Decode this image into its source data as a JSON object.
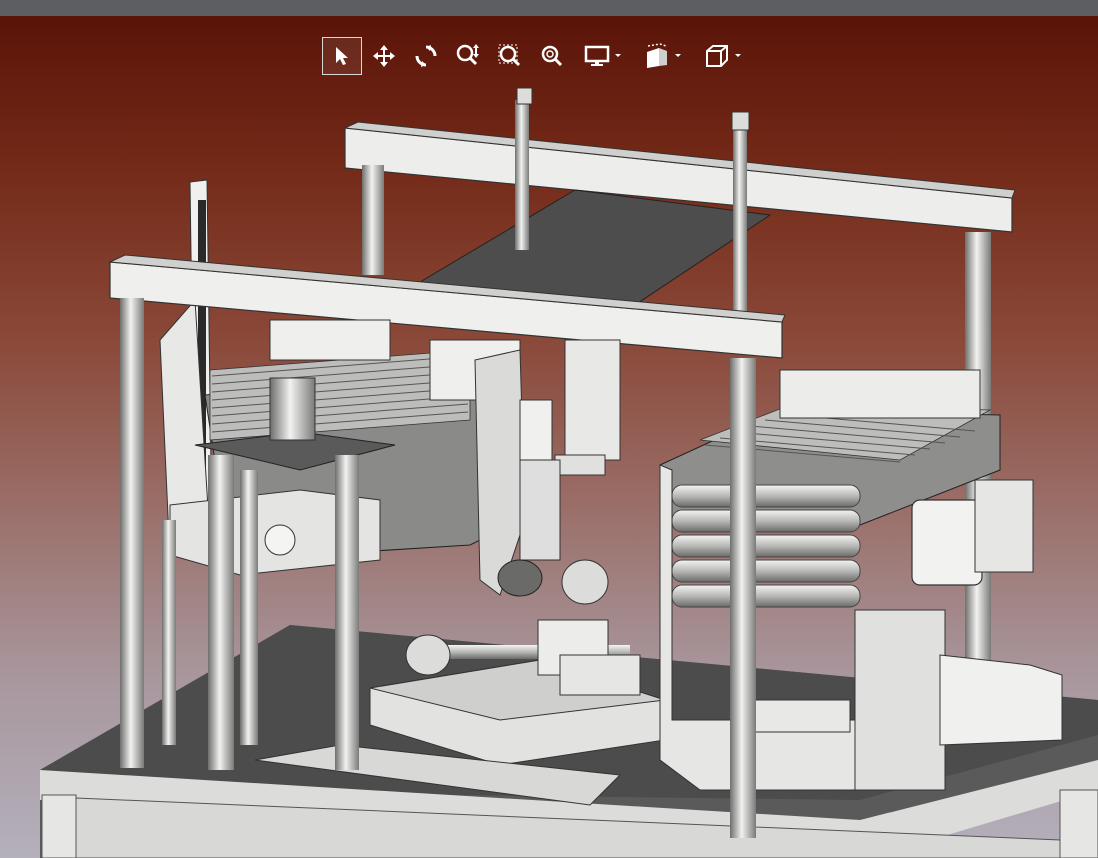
{
  "window": {
    "titlebar_color": "#5c5e62"
  },
  "viewport": {
    "background_top": "#5a1408",
    "background_bottom": "#b4b0bc",
    "model_fill": "#eeeeec",
    "model_shadow": "#4e4e4e"
  },
  "toolbar": {
    "tools": [
      {
        "name": "select-arrow-icon",
        "active": true,
        "dropdown": false
      },
      {
        "name": "pan-move-icon",
        "active": false,
        "dropdown": false
      },
      {
        "name": "rotate-icon",
        "active": false,
        "dropdown": false
      },
      {
        "name": "zoom-dynamic-icon",
        "active": false,
        "dropdown": false
      },
      {
        "name": "zoom-window-icon",
        "active": false,
        "dropdown": false
      },
      {
        "name": "zoom-fit-icon",
        "active": false,
        "dropdown": false
      },
      {
        "name": "display-mode-icon",
        "active": false,
        "dropdown": true
      },
      {
        "name": "section-view-icon",
        "active": false,
        "dropdown": true
      },
      {
        "name": "view-cube-icon",
        "active": false,
        "dropdown": true
      }
    ]
  }
}
